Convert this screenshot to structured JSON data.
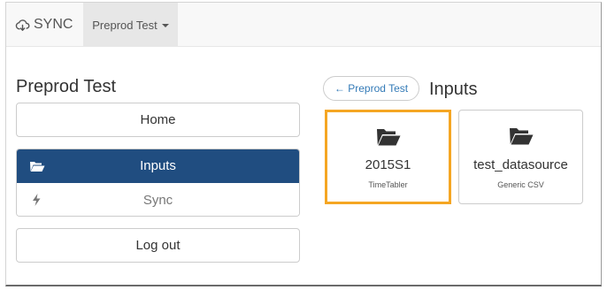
{
  "navbar": {
    "brand_label": "SYNC",
    "brand_icon": "cloud-sync-icon",
    "project_dropdown_label": "Preprod Test"
  },
  "sidebar": {
    "title": "Preprod Test",
    "home_label": "Home",
    "menu": [
      {
        "label": "Inputs",
        "icon": "folder-open-icon",
        "active": true
      },
      {
        "label": "Sync",
        "icon": "bolt-icon",
        "active": false
      }
    ],
    "logout_label": "Log out"
  },
  "main": {
    "back_label": "← Preprod Test",
    "title": "Inputs",
    "inputs": [
      {
        "name": "2015S1",
        "type": "TimeTabler",
        "selected": true,
        "icon": "folder-open-icon"
      },
      {
        "name": "test_datasource",
        "type": "Generic CSV",
        "selected": false,
        "icon": "folder-open-icon"
      }
    ]
  },
  "colors": {
    "active_item_bg": "#204d80",
    "selected_card_border": "#f5a623",
    "link": "#337ab7"
  }
}
